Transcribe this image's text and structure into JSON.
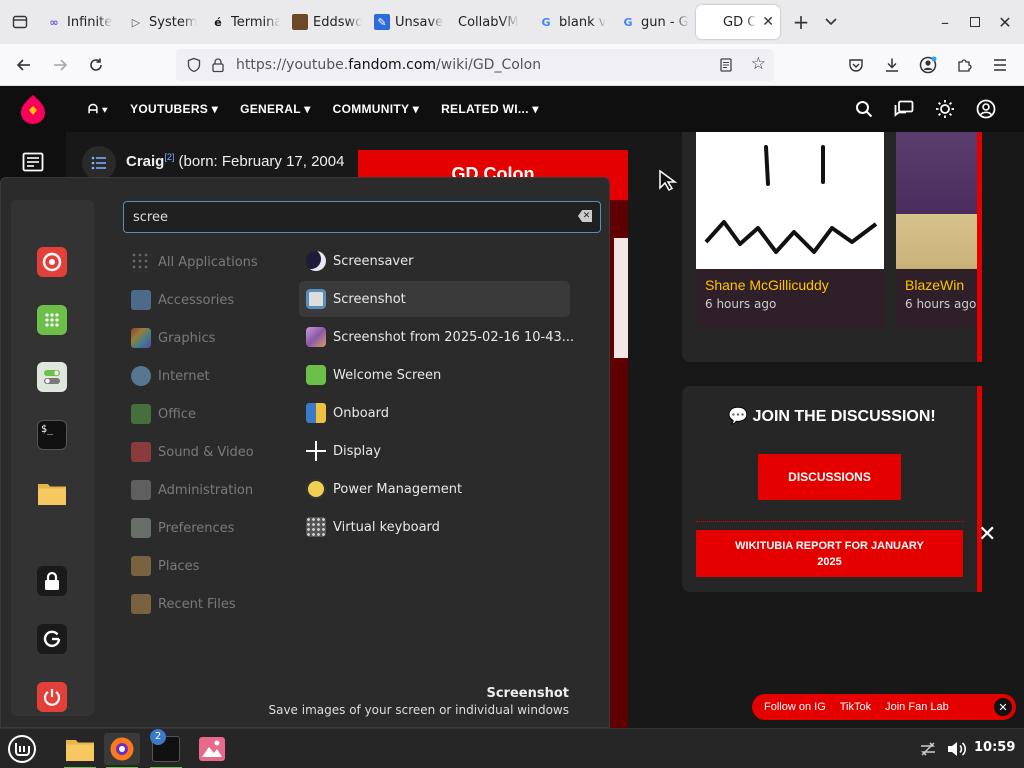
{
  "browser": {
    "tabs": [
      {
        "label": "Infinite",
        "icon": "infinite-icon"
      },
      {
        "label": "System",
        "icon": "play-icon"
      },
      {
        "label": "Terminal",
        "icon": "e-icon"
      },
      {
        "label": "Eddsworld",
        "icon": "house-icon"
      },
      {
        "label": "Unsaved",
        "icon": "doc-icon"
      },
      {
        "label": "CollabVM",
        "icon": ""
      },
      {
        "label": "blank v",
        "icon": "google-icon"
      },
      {
        "label": "gun - G",
        "icon": "google-icon"
      },
      {
        "label": "GD C",
        "icon": "fandom-icon",
        "active": true
      }
    ],
    "url_prefix": "https://youtube.",
    "url_domain": "fandom.com",
    "url_path": "/wiki/GD_Colon"
  },
  "fandom": {
    "nav": [
      "YOUTUBERS",
      "GENERAL",
      "COMMUNITY",
      "RELATED WI..."
    ],
    "article_name": "Craig",
    "article_ref": "[2]",
    "article_rest": " (born: February 17, 2004",
    "infobox_title": "GD Colon",
    "activity": [
      {
        "name": "Shane McGillicuddy",
        "time": "6 hours ago"
      },
      {
        "name": "BlazeWin",
        "time": "6 hours ago"
      }
    ],
    "discussion_title": "JOIN THE DISCUSSION!",
    "discussion_button": "DISCUSSIONS",
    "report_button": "WIKITUBIA REPORT FOR JANUARY 2025",
    "follow": [
      "Follow on IG",
      "TikTok",
      "Join Fan Lab"
    ]
  },
  "menu": {
    "search_value": "scree",
    "categories": [
      "All Applications",
      "Accessories",
      "Graphics",
      "Internet",
      "Office",
      "Sound & Video",
      "Administration",
      "Preferences",
      "Places",
      "Recent Files"
    ],
    "apps": [
      "Screensaver",
      "Screenshot",
      "Screenshot from 2025-02-16 10-43...",
      "Welcome Screen",
      "Onboard",
      "Display",
      "Power Management",
      "Virtual keyboard"
    ],
    "desc_title": "Screenshot",
    "desc_text": "Save images of your screen or individual windows"
  },
  "panel": {
    "clock": "10:59",
    "terminal_badge": "2"
  },
  "colors": {
    "fandom_red": "#e50000",
    "accent_blue": "#5a8db8"
  }
}
